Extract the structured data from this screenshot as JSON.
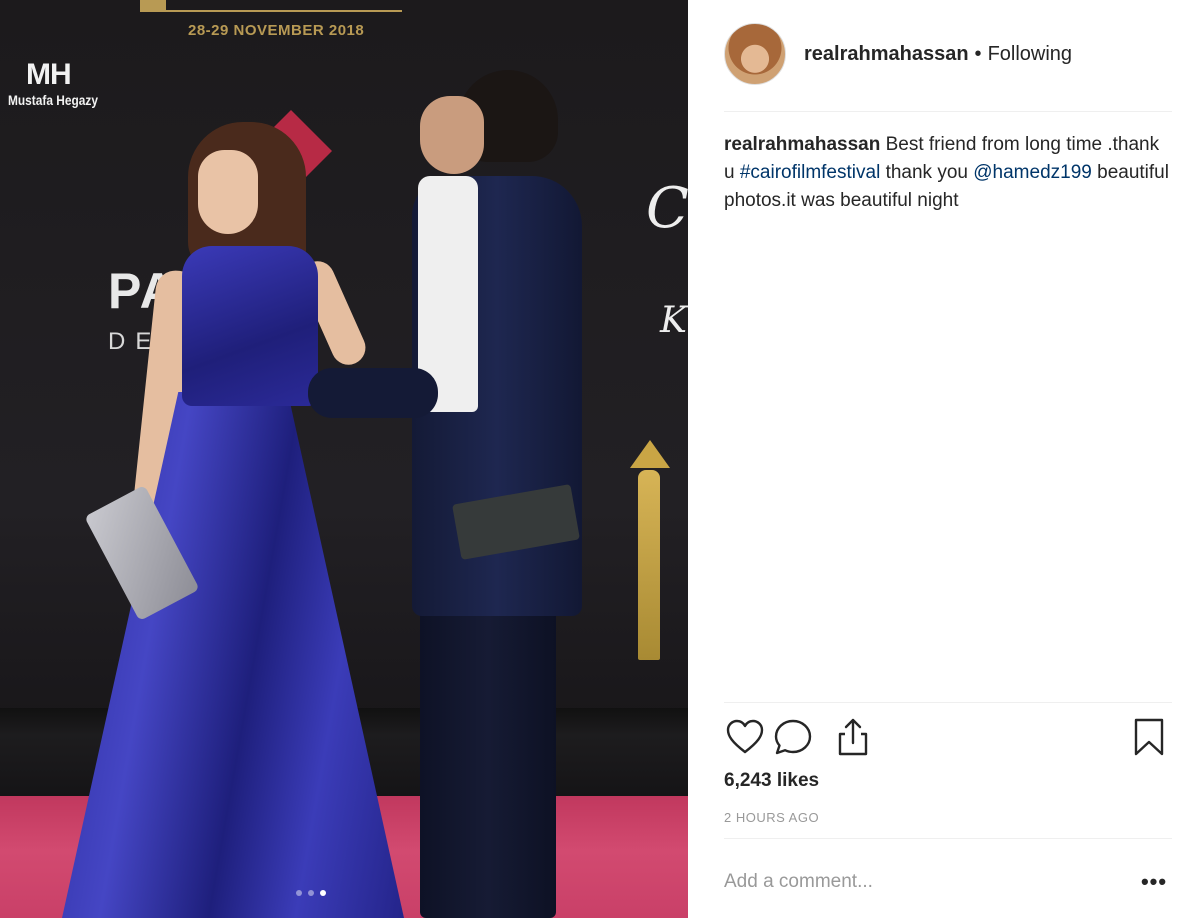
{
  "photo": {
    "event_date": "28-29 NOVEMBER 2018",
    "watermark_mark": "MH",
    "watermark_name": "Mustafa Hegazy",
    "sponsor_line1": "PA        LS",
    "sponsor_line2": "DE             TS",
    "carousel": {
      "count": 3,
      "active_index": 2
    }
  },
  "post": {
    "author": "realrahmahassan",
    "separator": "•",
    "follow_status": "Following",
    "caption": {
      "username": "realrahmahassan",
      "text_1": " Best friend from long time .thank u ",
      "hashtag": "#cairofilmfestival",
      "text_2": " thank you ",
      "mention": "@hamedz199",
      "text_3": " beautiful photos.it was beautiful night"
    },
    "likes": "6,243 likes",
    "timestamp": "2 HOURS AGO",
    "comment_placeholder": "Add a comment...",
    "more_label": "•••"
  },
  "icons": {
    "like": "heart-icon",
    "comment": "comment-bubble-icon",
    "share": "share-icon",
    "save": "bookmark-icon"
  },
  "colors": {
    "link": "#003569",
    "muted": "#999999",
    "text": "#262626"
  }
}
